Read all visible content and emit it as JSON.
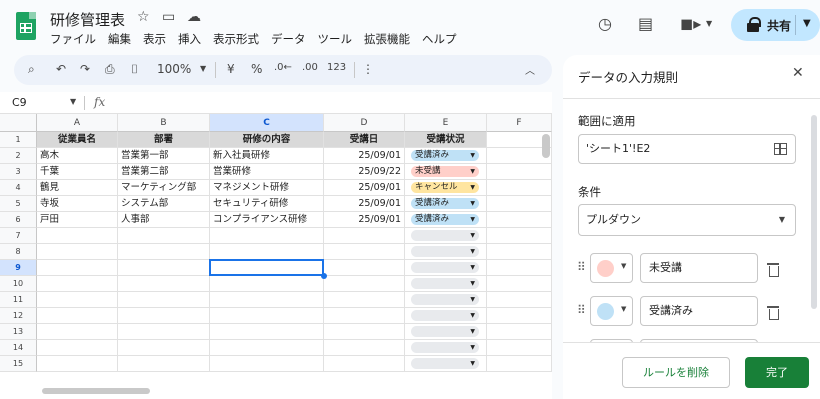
{
  "document": {
    "title": "研修管理表",
    "menu": [
      "ファイル",
      "編集",
      "表示",
      "挿入",
      "表示形式",
      "データ",
      "ツール",
      "拡張機能",
      "ヘルプ"
    ],
    "share_label": "共有"
  },
  "toolbar": {
    "zoom": "100%",
    "currency": "¥",
    "percent": "%",
    "decimal_decrease": ".0←",
    "decimal_increase": ".00",
    "number_format": "123"
  },
  "formula_bar": {
    "cell_ref": "C9",
    "fx": "fx",
    "value": ""
  },
  "sheet": {
    "columns": [
      "A",
      "B",
      "C",
      "D",
      "E",
      "F"
    ],
    "selected_column": "C",
    "row_numbers": [
      "1",
      "2",
      "3",
      "4",
      "5",
      "6",
      "7",
      "8",
      "9",
      "10",
      "11",
      "12",
      "13",
      "14",
      "15"
    ],
    "selected_row": "9",
    "headers": [
      "従業員名",
      "部署",
      "研修の内容",
      "受講日",
      "受講状況"
    ],
    "rows": [
      {
        "name": "高木",
        "dept": "営業第一部",
        "course": "新入社員研修",
        "date": "25/09/01",
        "status": "受講済み",
        "status_color": "#bfe1f6"
      },
      {
        "name": "千葉",
        "dept": "営業第二部",
        "course": "営業研修",
        "date": "25/09/22",
        "status": "未受講",
        "status_color": "#ffcfc9"
      },
      {
        "name": "鶴見",
        "dept": "マーケティング部",
        "course": "マネジメント研修",
        "date": "25/09/01",
        "status": "キャンセル",
        "status_color": "#ffe5a0"
      },
      {
        "name": "寺坂",
        "dept": "システム部",
        "course": "セキュリティ研修",
        "date": "25/09/01",
        "status": "受講済み",
        "status_color": "#bfe1f6"
      },
      {
        "name": "戸田",
        "dept": "人事部",
        "course": "コンプライアンス研修",
        "date": "25/09/01",
        "status": "受講済み",
        "status_color": "#bfe1f6"
      }
    ],
    "empty_chip_color": "#e8eaed"
  },
  "panel": {
    "title": "データの入力規則",
    "range_label": "範囲に適用",
    "range_value": "'シート1'!E2",
    "condition_label": "条件",
    "condition_value": "プルダウン",
    "options": [
      {
        "value": "未受講",
        "color": "#ffcfc9"
      },
      {
        "value": "受講済み",
        "color": "#bfe1f6"
      }
    ],
    "delete_rule_label": "ルールを削除",
    "done_label": "完了"
  }
}
